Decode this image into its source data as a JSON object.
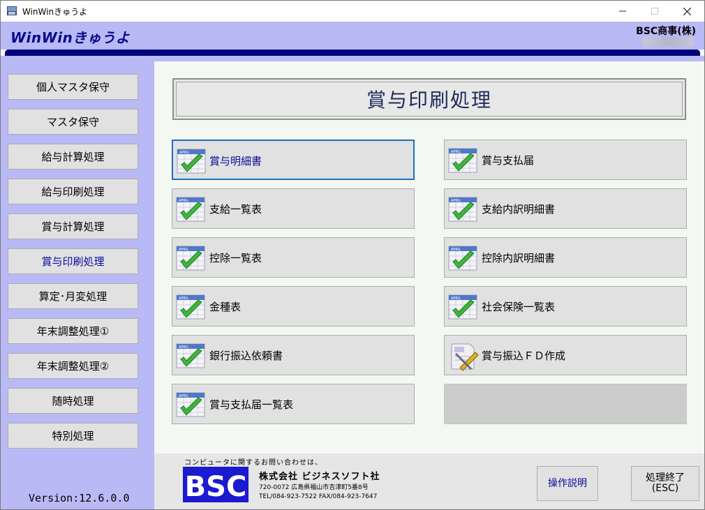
{
  "window": {
    "title": "WinWinきゅうよ"
  },
  "header": {
    "logo": "WinWinきゅうよ",
    "company": "BSC商事(株)"
  },
  "sidebar": {
    "items": [
      {
        "label": "個人マスタ保守"
      },
      {
        "label": "マスタ保守"
      },
      {
        "label": "給与計算処理"
      },
      {
        "label": "給与印刷処理"
      },
      {
        "label": "賞与計算処理"
      },
      {
        "label": "賞与印刷処理",
        "active": true
      },
      {
        "label": "算定･月変処理"
      },
      {
        "label": "年末調整処理①"
      },
      {
        "label": "年末調整処理②"
      },
      {
        "label": "随時処理"
      },
      {
        "label": "特別処理"
      }
    ],
    "version": "Version:12.6.0.0"
  },
  "main": {
    "title": "賞与印刷処理",
    "left_buttons": [
      {
        "label": "賞与明細書"
      },
      {
        "label": "支給一覧表"
      },
      {
        "label": "控除一覧表"
      },
      {
        "label": "金種表"
      },
      {
        "label": "銀行振込依頼書"
      },
      {
        "label": "賞与支払届一覧表"
      }
    ],
    "right_buttons": [
      {
        "label": "賞与支払届"
      },
      {
        "label": "支給内訳明細書"
      },
      {
        "label": "控除内訳明細書"
      },
      {
        "label": "社会保険一覧表"
      },
      {
        "label": "賞与振込ＦＤ作成"
      }
    ],
    "icon_text": "APRIL"
  },
  "footer": {
    "inquiry": "コンピュータに関するお問い合わせは、",
    "company": "株式会社 ビジネスソフト社",
    "address": "720-0072  広島県福山市吉津町5番8号",
    "tel": "TEL/084-923-7522  FAX/084-923-7647",
    "logo_text": "BSC",
    "help_label": "操作説明",
    "exit_label_1": "処理終了",
    "exit_label_2": "(ESC)"
  },
  "colors": {
    "accent_blue": "#0a0aa0",
    "header_lavender": "#b9b9f6",
    "navy": "#00007a",
    "focus_border": "#1a6fc4"
  }
}
